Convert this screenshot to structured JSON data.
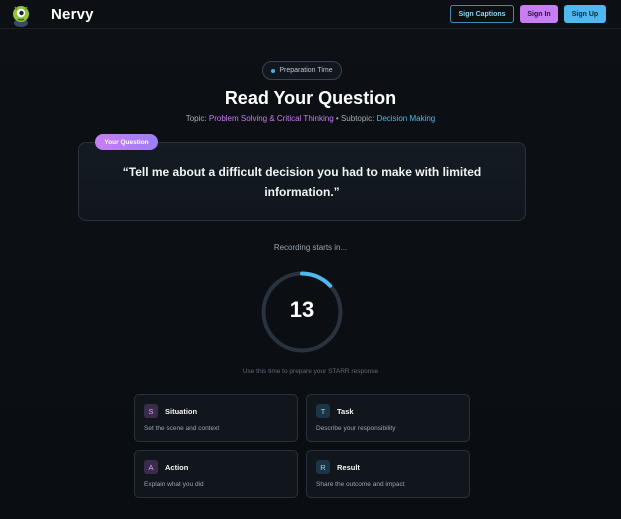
{
  "header": {
    "brand": "Nervy",
    "buttons": {
      "captions": "Sign Captions",
      "signin": "Sign In",
      "signup": "Sign Up"
    }
  },
  "main": {
    "pill": "Preparation Time",
    "title": "Read Your Question",
    "topic_label": "Topic:",
    "topic_value": "Problem Solving & Critical Thinking",
    "separator": "•",
    "subtopic_label": "Subtopic:",
    "subtopic_value": "Decision Making",
    "question_badge": "Your Question",
    "question": "“Tell me about a difficult decision you had to make with limited information.”",
    "recording_label": "Recording starts in...",
    "countdown": "13",
    "countdown_progress": 0.13,
    "hint": "Use this time to prepare your STARR response"
  },
  "starr": [
    {
      "letter": "S",
      "name": "Situation",
      "desc": "Set the scene and context",
      "color": "#c77ef0"
    },
    {
      "letter": "T",
      "name": "Task",
      "desc": "Describe your responsibility",
      "color": "#4fb8ee"
    },
    {
      "letter": "A",
      "name": "Action",
      "desc": "Explain what you did",
      "color": "#c77ef0"
    },
    {
      "letter": "R",
      "name": "Result",
      "desc": "Share the outcome and impact",
      "color": "#4fb8ee"
    }
  ],
  "colors": {
    "accent_purple": "#c77ef0",
    "accent_blue": "#4fb8ee",
    "background": "#0b0e12"
  }
}
